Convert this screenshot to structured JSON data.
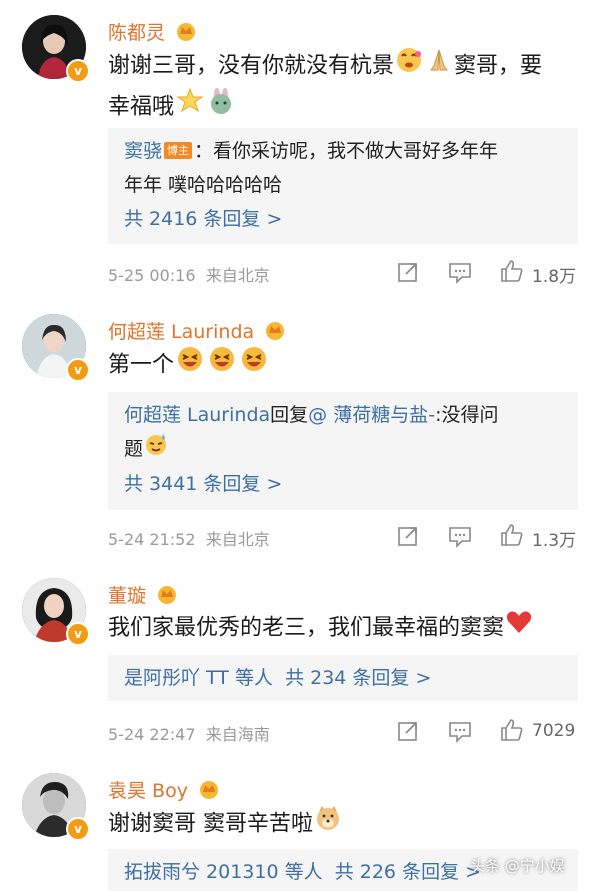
{
  "comments": [
    {
      "name": "陈都灵",
      "text_a": "谢谢三哥，没有你就没有杭景",
      "text_b": "窦哥，要",
      "text_c": "幸福哦",
      "reply": {
        "author": "窦骁",
        "badge": "博主",
        "text_a": "：看你采访呢，我不做大哥好多年年",
        "text_b": "年年 噗哈哈哈哈哈"
      },
      "reply_count": "共 2416 条回复 >",
      "time": "5-25 00:16",
      "location": "来自北京",
      "likes": "1.8万"
    },
    {
      "name": "何超莲 Laurinda",
      "text_a": "第一个",
      "reply": {
        "author": "何超莲 Laurinda",
        "reply_word": "回复",
        "mention": "@ 薄荷糖与盐-",
        "text_a": ":没得问",
        "text_b": "题"
      },
      "reply_count": "共 3441 条回复 >",
      "time": "5-24 21:52",
      "location": "来自北京",
      "likes": "1.3万"
    },
    {
      "name": "董璇",
      "text_a": "我们家最优秀的老三，我们最幸福的窦窦",
      "reply_summary": "是阿彤吖 TT 等人",
      "reply_count": "共 234 条回复 >",
      "time": "5-24 22:47",
      "location": "来自海南",
      "likes": "7029"
    },
    {
      "name": "袁昊 Boy",
      "text_a": "谢谢窦哥 窦哥辛苦啦",
      "reply_summary": "拓拔雨兮 201310 等人",
      "reply_count": "共 226 条回复 >"
    }
  ],
  "watermark": "头条 @宁小娱",
  "colors": {
    "name": "#e1742c",
    "link": "#3d6fa3",
    "meta": "#9a9a9a",
    "reply_bg": "#f5f5f5"
  }
}
